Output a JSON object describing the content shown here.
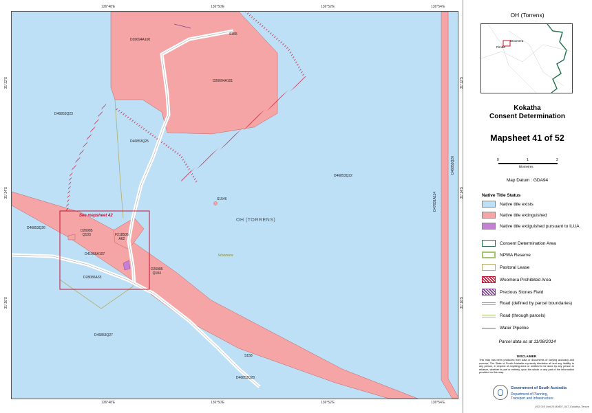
{
  "map": {
    "top_ticks": [
      "136°48'E",
      "136°50'E",
      "136°52'E",
      "136°54'E"
    ],
    "bottom_ticks": [
      "136°48'E",
      "136°50'E",
      "136°52'E",
      "136°54'E"
    ],
    "left_ticks": [
      "31°12'S",
      "31°14'S",
      "31°16'S"
    ],
    "right_ticks": [
      "31°12'S",
      "31°14'S",
      "31°16'S"
    ],
    "parcels": {
      "p1": "D26694A100",
      "p2": "S355",
      "p3": "D26694A101",
      "p4": "D46853Q23",
      "p5": "D46853Q25",
      "p6": "D46853Q22",
      "p7": "D46853Q20",
      "p8": "S1546",
      "p9": "D47831A114",
      "p10": "D46853Q26",
      "p11a": "D26985",
      "p11b": "Q103",
      "p12a": "F218505",
      "p12b": "A62",
      "p13": "D41066A107",
      "p14a": "D26985",
      "p14b": "Q104",
      "p15": "D28086A33",
      "p16": "D46853Q27",
      "p17": "S158",
      "p18": "D46853Q28"
    },
    "see_mapsheet": "See mapsheet 42",
    "area_label": "OH (TORRENS)",
    "town_label": "Woomera"
  },
  "inset": {
    "title": "OH (Torrens)",
    "town1": "Woomera",
    "town2": "Pimba"
  },
  "header": {
    "line1": "Kokatha",
    "line2": "Consent Determination",
    "mapsheet": "Mapsheet 41 of 52"
  },
  "scale": {
    "t0": "0",
    "t1": "1",
    "t2": "2",
    "unit": "kilometres"
  },
  "datum": "Map Datum :  GDA94",
  "legend": {
    "title": "Native Title Status",
    "items": [
      {
        "label": "Native title exists"
      },
      {
        "label": "Native title extinguished"
      },
      {
        "label": "Native title extiguished pursuant to ILUA"
      },
      {
        "label": "Consent Determination Area"
      },
      {
        "label": "NPWA Reserve"
      },
      {
        "label": "Pastoral Lease"
      },
      {
        "label": "Woomera Prohibited Area"
      },
      {
        "label": "Precious Stones Field"
      },
      {
        "label": "Road (defined by parcel boundaries)"
      },
      {
        "label": "Road (through parcels)"
      },
      {
        "label": "Water Pipeline"
      }
    ]
  },
  "parcel_date": "Parcel data as at 11/08/2014",
  "disclaimer": {
    "title": "DISCLAIMER",
    "text": "This map has been produced from data or documents of varying accuracy and sources. The State of South Australia expressly disclaims all and any liability to any person, in respect of anything done or omitted to be done by any person in reliance, whether in part or entirely, upon the whole or any part of the information provided on this map."
  },
  "gov": {
    "line1": "Government of South Australia",
    "line2": "Department of Planning,",
    "line3": "Transport and Infrastructure"
  },
  "footer": "LSG GIS Unit  20140807_047_Kokatha_Tenure",
  "colors": {
    "exists": "#bde0f7",
    "extinguished": "#f5a5a5",
    "ilua": "#c47fd6",
    "consent": "#1f6e4a",
    "npwa": "#a6c46e",
    "pastoral": "#b5ad6a",
    "woomera": "#c8102e",
    "precious": "#7e3d8f"
  }
}
